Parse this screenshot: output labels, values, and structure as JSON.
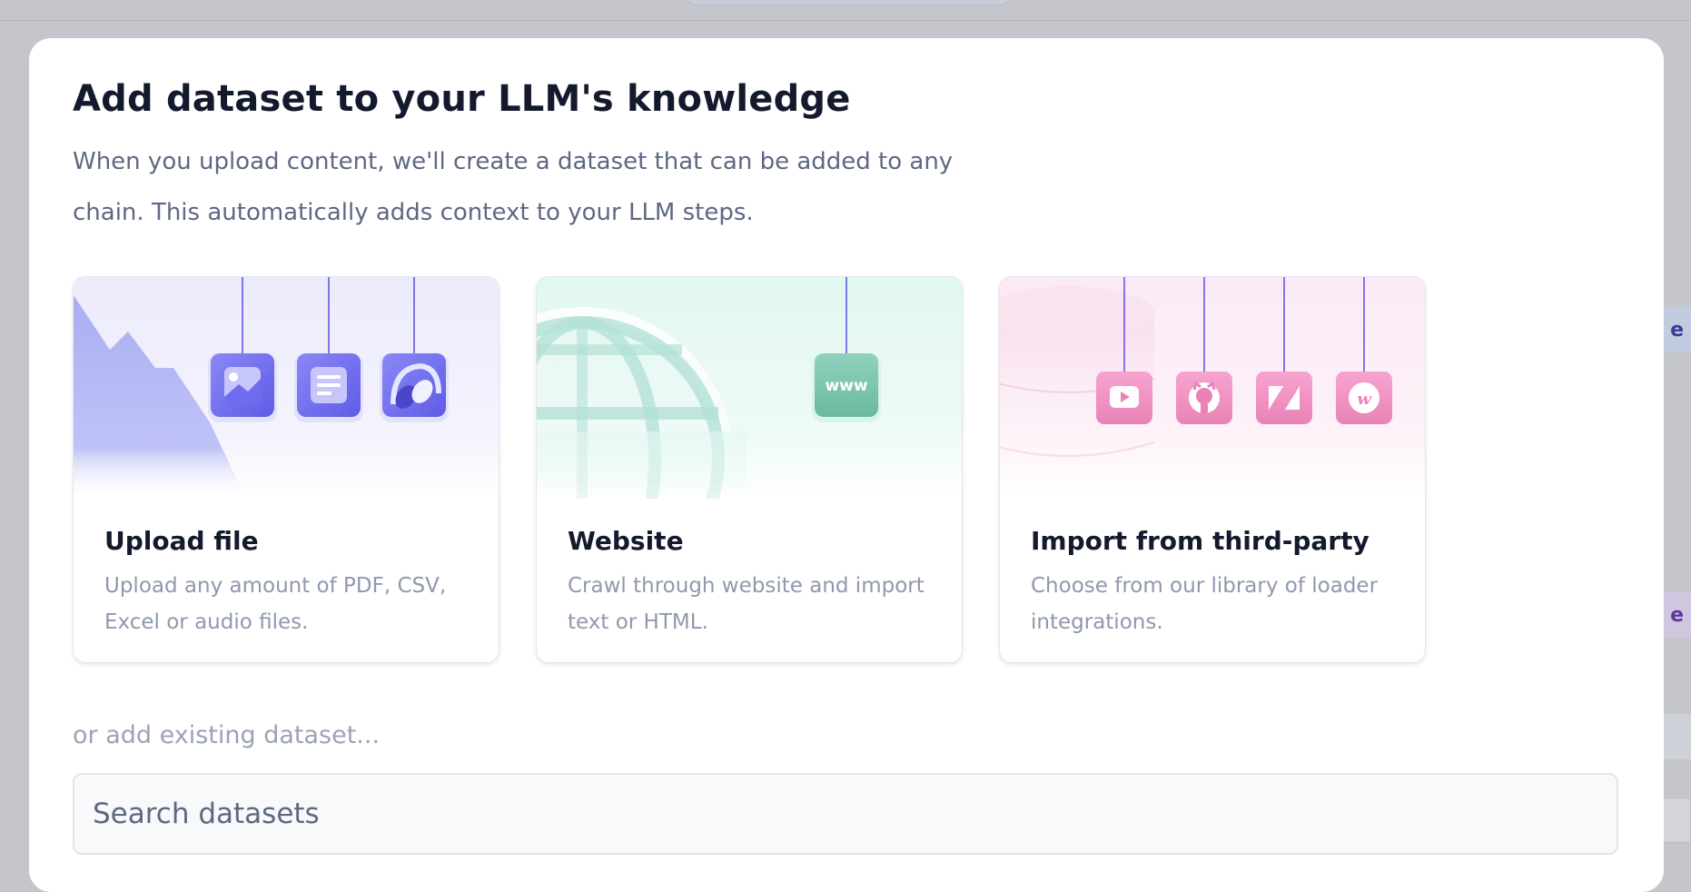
{
  "modal": {
    "title": "Add dataset to your LLM's knowledge",
    "subtitle": "When you upload content, we'll create a dataset that can be added to any chain. This automatically adds context to your LLM steps."
  },
  "cards": [
    {
      "title": "Upload file",
      "description": "Upload any amount of PDF, CSV, Excel or audio files.",
      "icons": [
        "image-icon",
        "document-icon",
        "audio-icon"
      ]
    },
    {
      "title": "Website",
      "description": "Crawl through website and import text or HTML.",
      "icon_text": "www",
      "icons": [
        "globe-icon",
        "www-icon"
      ]
    },
    {
      "title": "Import from third-party",
      "description": "Choose from our library of loader integrations.",
      "icons": [
        "youtube-icon",
        "github-icon",
        "zendesk-icon",
        "webflow-icon"
      ]
    }
  ],
  "existing_label": "or add existing dataset...",
  "search": {
    "placeholder": "Search datasets",
    "value": ""
  },
  "background_badges": [
    "e",
    "e"
  ],
  "colors": {
    "upload_accent": "#6f6cf0",
    "website_accent": "#7cc7b0",
    "thirdparty_accent": "#f08cc0",
    "title_text": "#141a2e",
    "muted_text": "#5e6882"
  }
}
